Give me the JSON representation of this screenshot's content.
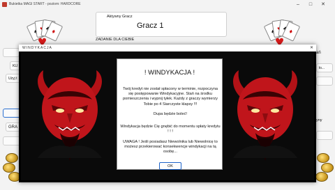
{
  "app": {
    "title": "Bukietka MAGI START - poziom: HARDCORE"
  },
  "top_panel": {
    "group_label": "Aktywny Gracz",
    "player_name": "Gracz 1",
    "task_label": "ZADANIE DLA CIEBIE"
  },
  "left_column": {
    "button_1": "KLI",
    "button_2": "Użyj t",
    "button_3": "GRA"
  },
  "right_column": {
    "label_1": "ań",
    "label_2": "ło...",
    "label_3": "yny"
  },
  "dialog": {
    "window_title": "WINDYKACJA",
    "heading": "! WINDYKACJA !",
    "paragraph_1": "Twój kredyt nie został spłacony w terminie, rozpoczyna się postępowanie Windykacyjne. Stań na środku pomieszczenia i wypnij tyłek. Każdy z graczy wymierzy Tobie po 4 Siarczyste klapsy !!!",
    "paragraph_1_end": "Dupa będzie boleć!",
    "paragraph_2": "Windykacja będzie Cię gnębić do momentu spłaty kredytu ! ! !",
    "paragraph_3": "UWAGA ! Jeśli posiadasz Niewolnika lub Niewolnicę to możesz przekierować konsekwencje windykacji na tą osobę...",
    "ok_label": "OK"
  },
  "colors": {
    "devil_red": "#c0151b",
    "devil_dark": "#5a0508",
    "dialog_bg": "#000000",
    "accent_blue": "#1e64c8"
  },
  "icons": {
    "app": "app-icon",
    "close": "close-icon",
    "minimize": "minimize-icon",
    "maximize": "maximize-icon"
  }
}
